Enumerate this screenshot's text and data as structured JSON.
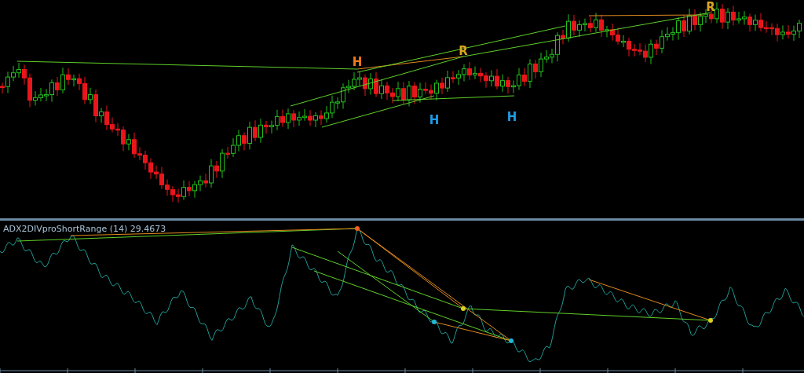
{
  "price_panel": {
    "pattern_labels": [
      {
        "text": "H",
        "color": "#f07a1c"
      },
      {
        "text": "R",
        "color": "#d9a520"
      },
      {
        "text": "H",
        "color": "#1e9be6"
      },
      {
        "text": "H",
        "color": "#1e9be6"
      },
      {
        "text": "R",
        "color": "#d9a520"
      }
    ]
  },
  "indicator_panel": {
    "title": "ADX2DIVproShortRange (14) 29.4673"
  }
}
